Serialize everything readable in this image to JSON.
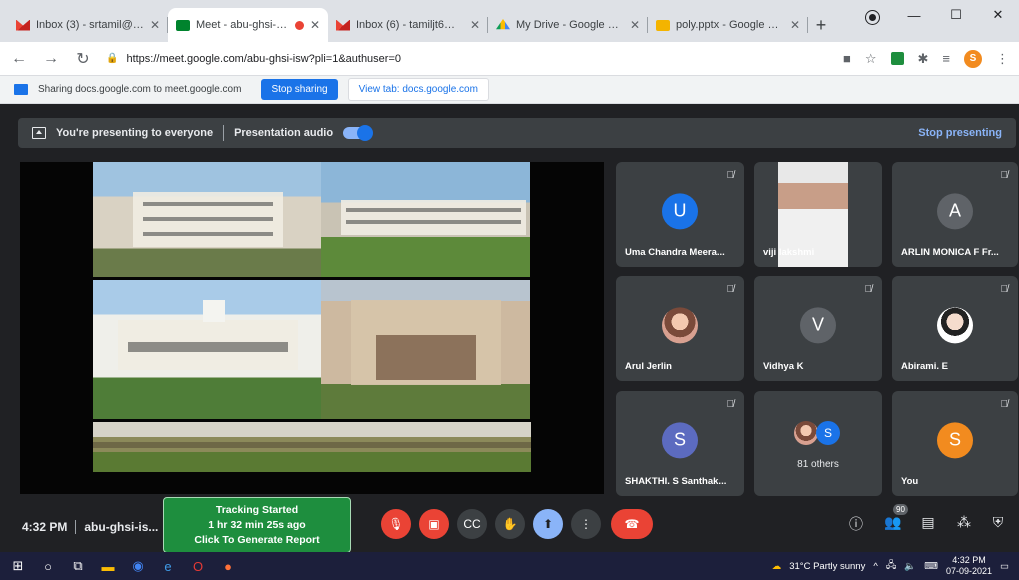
{
  "browser": {
    "tabs": [
      {
        "label": "Inbox (3) - srtamil@auxilium",
        "icon": "gmail-icon",
        "active": false
      },
      {
        "label": "Meet - abu-ghsi-isw",
        "icon": "meet-icon",
        "active": true,
        "recording": true
      },
      {
        "label": "Inbox (6) - tamiljt6@gmail.co",
        "icon": "gmail-icon",
        "active": false
      },
      {
        "label": "My Drive - Google Drive",
        "icon": "drive-icon",
        "active": false
      },
      {
        "label": "poly.pptx - Google Slides",
        "icon": "slides-icon",
        "active": false
      }
    ],
    "url": "https://meet.google.com/abu-ghsi-isw?pli=1&authuser=0",
    "profile_initial": "S"
  },
  "sharing_bar": {
    "text": "Sharing docs.google.com to meet.google.com",
    "stop_label": "Stop sharing",
    "view_label": "View tab: docs.google.com"
  },
  "presenting": {
    "text": "You're presenting to everyone",
    "audio_label": "Presentation audio",
    "stop_label": "Stop presenting"
  },
  "participants": [
    {
      "name": "Uma Chandra Meera...",
      "initial": "U",
      "color": "#1a73e8"
    },
    {
      "name": "viji lakshmi",
      "initial": "",
      "color": ""
    },
    {
      "name": "ARLIN MONICA F Fr...",
      "initial": "A",
      "color": "#5f6368"
    },
    {
      "name": "Arul Jerlin",
      "initial": "",
      "color": ""
    },
    {
      "name": "Vidhya K",
      "initial": "V",
      "color": "#5f6368"
    },
    {
      "name": "Abirami. E",
      "initial": "",
      "color": ""
    },
    {
      "name": "SHAKTHI. S Santhak...",
      "initial": "S",
      "color": "#5c6bc0"
    },
    {
      "name": "81 others",
      "initial": "S",
      "color": "#1a73e8"
    },
    {
      "name": "You",
      "initial": "S",
      "color": "#f28b1f"
    }
  ],
  "bottom": {
    "time": "4:32 PM",
    "meeting_code": "abu-ghsi-is...",
    "tracking": {
      "line1": "Tracking Started",
      "line2": "1 hr 32 min 25s ago",
      "line3": "Click To Generate Report"
    },
    "participant_count": "90"
  },
  "taskbar": {
    "weather": "31°C  Partly sunny",
    "time": "4:32 PM",
    "date": "07-09-2021"
  }
}
